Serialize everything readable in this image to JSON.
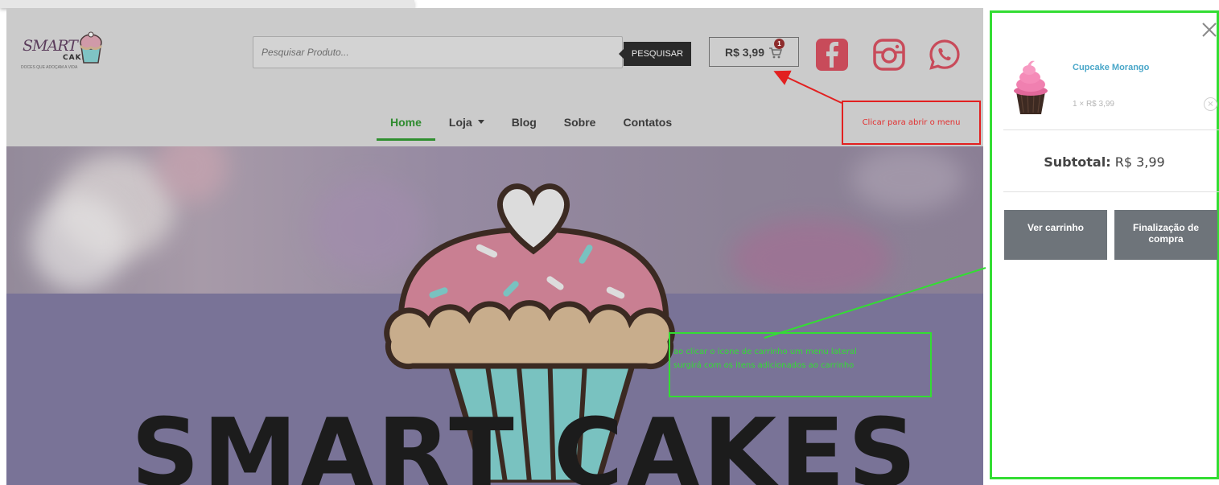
{
  "logo": {
    "script_text": "SMART",
    "cakes_text": "CAKES",
    "tagline": "DOCES QUE ADOÇAM A VIDA"
  },
  "search": {
    "placeholder": "Pesquisar Produto...",
    "button_label": "PESQUISAR"
  },
  "cart": {
    "total": "R$ 3,99",
    "badge_count": "1"
  },
  "social": {
    "facebook_color": "#c84b5a",
    "instagram_color": "#c84b5a",
    "whatsapp_color": "#c84b5a"
  },
  "nav": {
    "items": [
      {
        "label": "Home",
        "active": true
      },
      {
        "label": "Loja",
        "dropdown": true
      },
      {
        "label": "Blog"
      },
      {
        "label": "Sobre"
      },
      {
        "label": "Contatos"
      }
    ]
  },
  "hero": {
    "title": "SMART CAKES"
  },
  "annotations": {
    "red_text": "Clicar para abrir o menu",
    "green_lines": [
      "ao clicar o icone de carrinho um menu lateral",
      "surgirá com os itens adicionados ao carrinho"
    ],
    "red_color": "#e22020",
    "green_color": "#33dd33"
  },
  "side_cart": {
    "product_name": "Cupcake Morango",
    "product_qty": "1 × R$ 3,99",
    "subtotal_label": "Subtotal:",
    "subtotal_value": "R$ 3,99",
    "view_cart_label": "Ver carrinho",
    "checkout_label": "Finalização de compra"
  }
}
